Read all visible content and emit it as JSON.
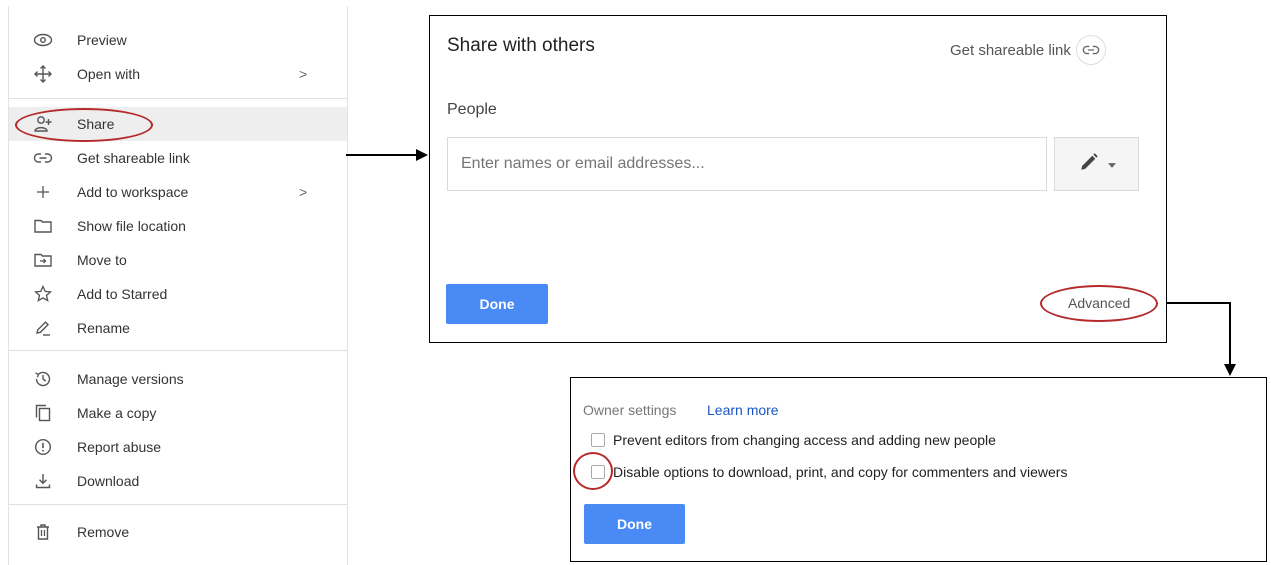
{
  "menu": {
    "items": [
      {
        "label": "Preview",
        "icon": "eye-icon"
      },
      {
        "label": "Open with",
        "icon": "move-arrows-icon",
        "submenu": true
      },
      {
        "label": "Share",
        "icon": "add-person-icon",
        "highlighted": true
      },
      {
        "label": "Get shareable link",
        "icon": "link-icon"
      },
      {
        "label": "Add to workspace",
        "icon": "plus-icon",
        "submenu": true
      },
      {
        "label": "Show file location",
        "icon": "folder-icon"
      },
      {
        "label": "Move to",
        "icon": "move-to-folder-icon"
      },
      {
        "label": "Add to Starred",
        "icon": "star-icon"
      },
      {
        "label": "Rename",
        "icon": "pencil-icon"
      },
      {
        "label": "Manage versions",
        "icon": "history-icon"
      },
      {
        "label": "Make a copy",
        "icon": "copy-icon"
      },
      {
        "label": "Report abuse",
        "icon": "alert-icon"
      },
      {
        "label": "Download",
        "icon": "download-icon"
      },
      {
        "label": "Remove",
        "icon": "trash-icon"
      }
    ],
    "submenu_glyph": ">"
  },
  "share_dialog": {
    "title": "Share with others",
    "shareable_link": "Get shareable link",
    "people_label": "People",
    "input_placeholder": "Enter names or email addresses...",
    "done": "Done",
    "advanced": "Advanced"
  },
  "advanced_dialog": {
    "owner_settings": "Owner settings",
    "learn_more": "Learn more",
    "options": [
      {
        "label": "Prevent editors from changing access and adding new people",
        "checked": false
      },
      {
        "label": "Disable options to download, print, and copy for commenters and viewers",
        "checked": false
      }
    ],
    "done": "Done"
  },
  "colors": {
    "primary_button": "#4a8af4",
    "highlight_oval": "#b52a2a",
    "link": "#1a56c4"
  }
}
